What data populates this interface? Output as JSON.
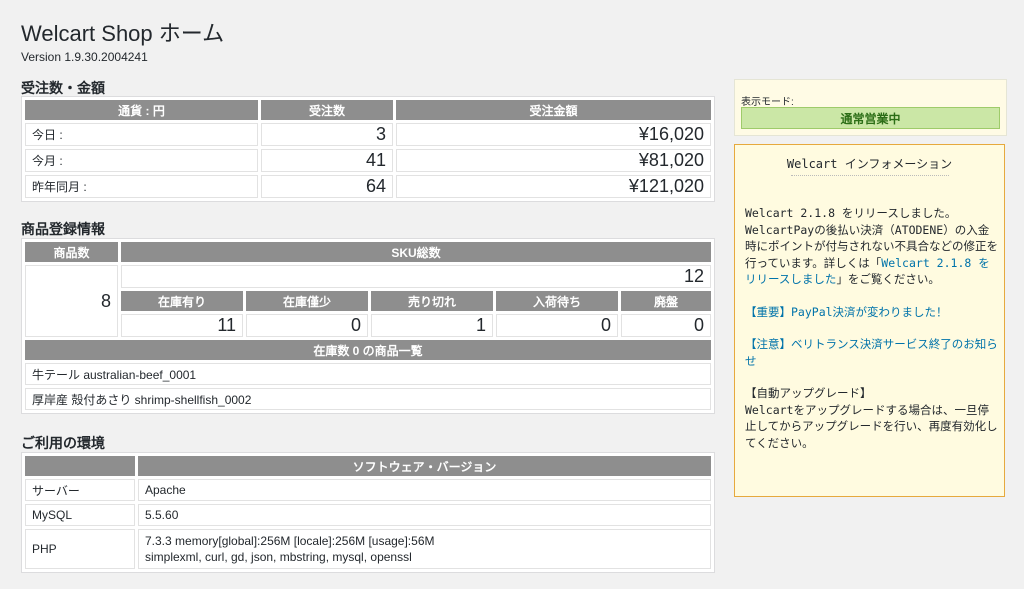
{
  "page": {
    "title": "Welcart Shop ホーム",
    "version": "Version 1.9.30.2004241"
  },
  "orders": {
    "heading": "受注数・金額",
    "headers": [
      "通貨 : 円",
      "受注数",
      "受注金額"
    ],
    "rows": [
      {
        "label": "今日 :",
        "count": "3",
        "amount": "¥16,020"
      },
      {
        "label": "今月 :",
        "count": "41",
        "amount": "¥81,020"
      },
      {
        "label": "昨年同月 :",
        "count": "64",
        "amount": "¥121,020"
      }
    ]
  },
  "products": {
    "heading": "商品登録情報",
    "count_header": "商品数",
    "sku_header": "SKU総数",
    "product_count": "8",
    "sku_total": "12",
    "stock_headers": [
      "在庫有り",
      "在庫僅少",
      "売り切れ",
      "入荷待ち",
      "廃盤"
    ],
    "stock_values": [
      "11",
      "0",
      "1",
      "0",
      "0"
    ],
    "zero_stock_header": "在庫数 0 の商品一覧",
    "zero_stock_items": [
      "牛テール australian-beef_0001",
      "厚岸産 殻付あさり shrimp-shellfish_0002"
    ]
  },
  "environment": {
    "heading": "ご利用の環境",
    "header": "ソフトウェア・バージョン",
    "rows": [
      {
        "label": "サーバー",
        "value": "Apache"
      },
      {
        "label": "MySQL",
        "value": "5.5.60"
      },
      {
        "label": "PHP",
        "value": "7.3.3 memory[global]:256M [locale]:256M [usage]:56M",
        "value2": "simplexml, curl, gd, json, mbstring, mysql, openssl"
      }
    ]
  },
  "mode": {
    "label": "表示モード:",
    "value": "通常営業中"
  },
  "info": {
    "title": "Welcart インフォメーション",
    "p1_text": "Welcart 2.1.8 をリリースしました。WelcartPayの後払い決済（ATODENE）の入金時にポイントが付与されない不具合などの修正を行っています。詳しくは「",
    "p1_link": "Welcart 2.1.8 をリリースしました",
    "p1_tail": "」をご覧ください。",
    "link2": "【重要】PayPal決済が変わりました！",
    "link3": "【注意】ベリトランス決済サービス終了のお知らせ",
    "p4_title": "【自動アップグレード】",
    "p4_text": "Welcartをアップグレードする場合は、一旦停止してからアップグレードを行い、再度有効化してください。"
  },
  "colors": {
    "header_bg": "#8e8e8e",
    "link": "#0073aa",
    "mode_bg": "#cbe7a6",
    "info_border": "#e6a93d",
    "info_bg": "#fffbe0"
  }
}
